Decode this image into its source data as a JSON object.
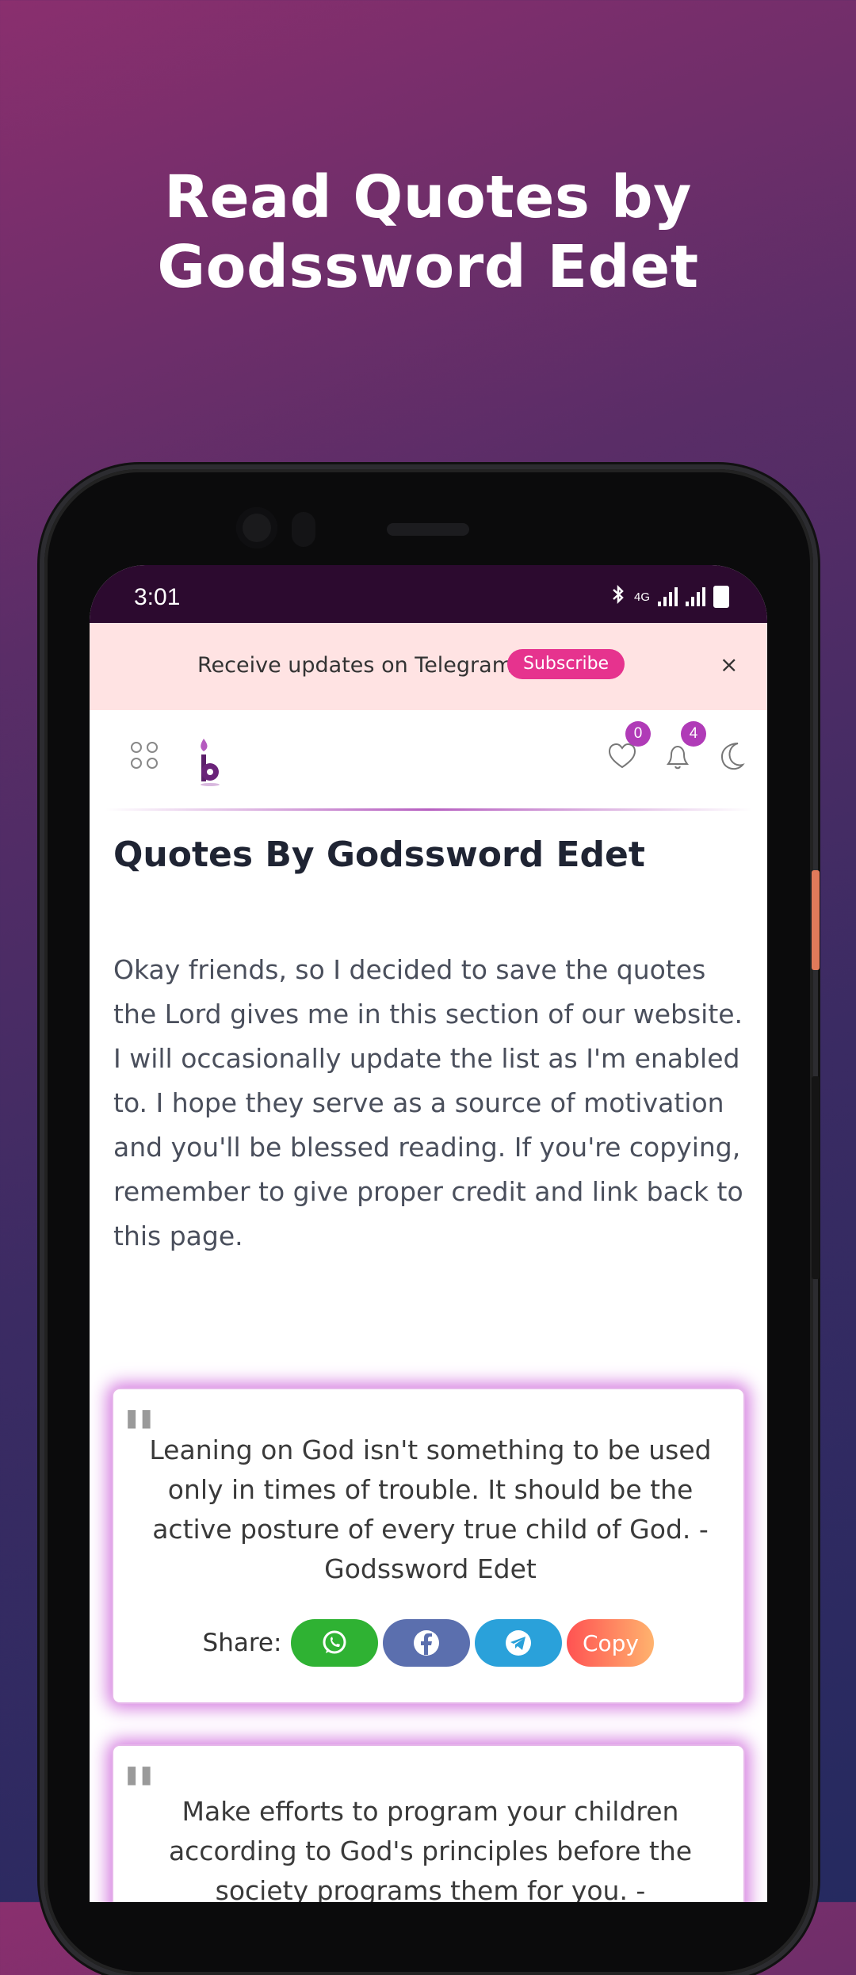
{
  "promo": {
    "title": "Read Quotes by Godssword Edet"
  },
  "status_bar": {
    "time": "3:01",
    "network": "4G"
  },
  "telegram_banner": {
    "text": "Receive updates on Telegram",
    "subscribe_label": "Subscribe",
    "close_label": "×"
  },
  "header": {
    "favorites_count": "0",
    "notifications_count": "4",
    "icons": [
      "apps-grid-icon",
      "logo-icon",
      "heart-icon",
      "bell-icon",
      "moon-icon"
    ]
  },
  "main": {
    "title": "Quotes By Godssword Edet",
    "intro": "Okay friends, so I decided to save the quotes the Lord gives me in this section of our website. I will occasionally update the list as I'm enabled to. I hope they serve as a source of motivation and you'll be blessed reading. If you're copying, remember to give proper credit and link back to this page.",
    "quotes": [
      {
        "text": "Leaning on God isn't something to be used only in times of trouble. It should be the active posture of every true child of God. - Godssword Edet"
      },
      {
        "text": "Make efforts to program your children according to God's principles before the society programs them for you. - Godssword"
      }
    ],
    "share": {
      "label": "Share:",
      "copy_label": "Copy"
    }
  },
  "colors": {
    "accent": "#b03bb7",
    "subscribe": "#e6338e",
    "whatsapp": "#2fb233",
    "facebook": "#5b6fae",
    "telegram": "#2aa1da"
  }
}
